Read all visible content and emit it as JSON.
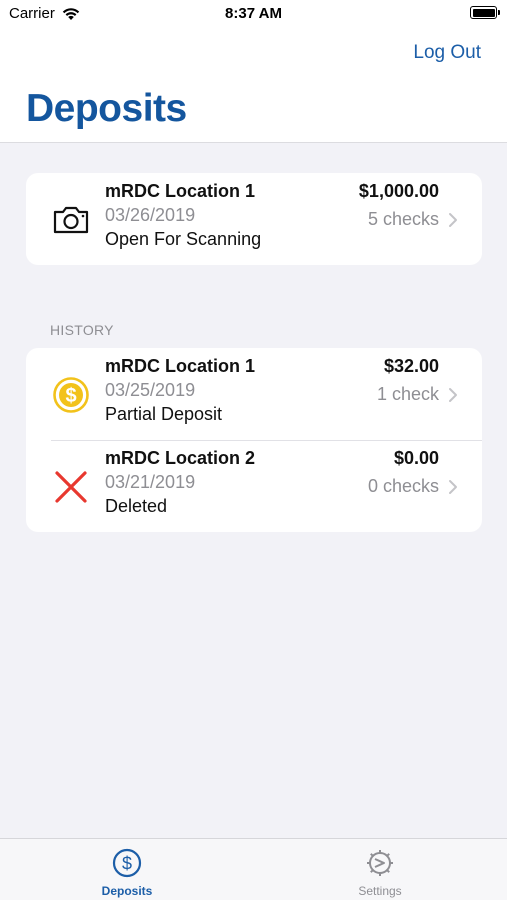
{
  "status_bar": {
    "carrier": "Carrier",
    "time": "8:37 AM"
  },
  "nav": {
    "logout_label": "Log Out",
    "title": "Deposits"
  },
  "current_deposit": {
    "name": "mRDC Location 1",
    "date": "03/26/2019",
    "status": "Open For Scanning",
    "amount": "$1,000.00",
    "checks": "5 checks",
    "icon": "camera-icon"
  },
  "history": {
    "header": "HISTORY",
    "items": [
      {
        "name": "mRDC Location 1",
        "date": "03/25/2019",
        "status": "Partial Deposit",
        "amount": "$32.00",
        "checks": "1 check",
        "icon": "dollar-coin-icon"
      },
      {
        "name": "mRDC Location 2",
        "date": "03/21/2019",
        "status": "Deleted",
        "amount": "$0.00",
        "checks": "0 checks",
        "icon": "red-x-icon"
      }
    ]
  },
  "tabbar": {
    "tabs": [
      {
        "label": "Deposits",
        "icon": "dollar-circle-icon",
        "active": true
      },
      {
        "label": "Settings",
        "icon": "gear-icon",
        "active": false
      }
    ]
  },
  "colors": {
    "accent": "#1c5ea8",
    "title": "#14569e",
    "background": "#f2f2f7",
    "secondary_text": "#8e8e93",
    "coin": "#f2c21b",
    "delete": "#e8382f"
  }
}
